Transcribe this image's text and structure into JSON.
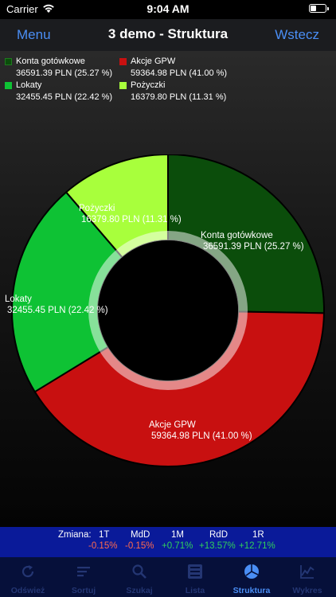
{
  "status": {
    "carrier": "Carrier",
    "time": "9:04 AM"
  },
  "nav": {
    "left": "Menu",
    "title": "3 demo - Struktura",
    "right": "Wstecz"
  },
  "legend": [
    {
      "name": "Konta gotówkowe",
      "value": "36591.39 PLN (25.27 %)",
      "color": "#0b4d0b"
    },
    {
      "name": "Akcje GPW",
      "value": "59364.98 PLN (41.00 %)",
      "color": "#c81010"
    },
    {
      "name": "Lokaty",
      "value": "32455.45 PLN (22.42 %)",
      "color": "#0ec234"
    },
    {
      "name": "Pożyczki",
      "value": "16379.80 PLN (11.31 %)",
      "color": "#a8ff3c"
    }
  ],
  "chart_data": {
    "type": "pie",
    "style": "donut",
    "categories": [
      "Konta gotówkowe",
      "Akcje GPW",
      "Lokaty",
      "Pożyczki"
    ],
    "values": [
      36591.39,
      59364.98,
      32455.45,
      16379.8
    ],
    "percent": [
      25.27,
      41.0,
      22.42,
      11.31
    ],
    "unit": "PLN",
    "labels": [
      {
        "name": "Konta gotówkowe",
        "value": "36591.39 PLN (25.27 %)"
      },
      {
        "name": "Akcje GPW",
        "value": "59364.98 PLN (41.00 %)"
      },
      {
        "name": "Lokaty",
        "value": "32455.45 PLN (22.42 %)"
      },
      {
        "name": "Pożyczki",
        "value": "16379.80 PLN (11.31 %)"
      }
    ],
    "colors": [
      "#0b4d0b",
      "#c81010",
      "#0ec234",
      "#a8ff3c"
    ],
    "legend_position": "top"
  },
  "change": {
    "title": "Zmiana:",
    "items": [
      {
        "label": "1T",
        "value": "-0.15%",
        "sign": "neg"
      },
      {
        "label": "MdD",
        "value": "-0.15%",
        "sign": "neg"
      },
      {
        "label": "1M",
        "value": "+0.71%",
        "sign": "pos"
      },
      {
        "label": "RdD",
        "value": "+13.57%",
        "sign": "pos"
      },
      {
        "label": "1R",
        "value": "+12.71%",
        "sign": "pos"
      }
    ]
  },
  "tabs": [
    {
      "label": "Odśwież",
      "icon": "refresh-icon"
    },
    {
      "label": "Sortuj",
      "icon": "sort-icon"
    },
    {
      "label": "Szukaj",
      "icon": "search-icon"
    },
    {
      "label": "Lista",
      "icon": "list-icon"
    },
    {
      "label": "Struktura",
      "icon": "pie-chart-icon",
      "active": true
    },
    {
      "label": "Wykres",
      "icon": "line-chart-icon"
    }
  ]
}
